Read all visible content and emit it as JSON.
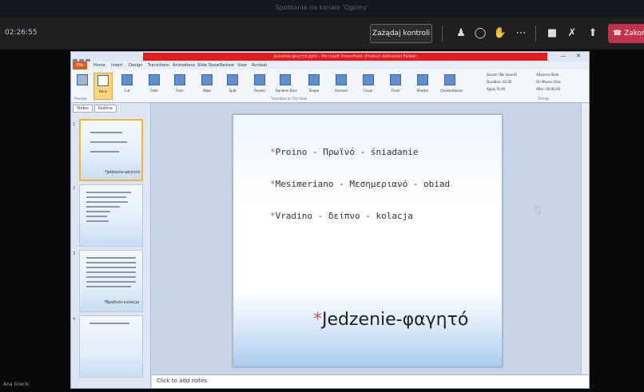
{
  "teams": {
    "window_title": "Spotkanie na kanale 'Ogólny'",
    "timer": "02:26:55",
    "request_control": "Zażądaj kontroli",
    "leave": "Zakończ",
    "participant": "Ana Grecki"
  },
  "powerpoint": {
    "title": "Jedzenie-φαγητό.pptx - Microsoft PowerPoint (Product Activation Failed)",
    "file_tab": "File",
    "tabs": [
      "Home",
      "Insert",
      "Design",
      "Transitions",
      "Animations",
      "Slide Show",
      "Review",
      "View",
      "Acrobat"
    ],
    "transitions": [
      "None",
      "Cut",
      "Fade",
      "Push",
      "Wipe",
      "Split",
      "Reveal",
      "Random Bars",
      "Shape",
      "Uncover",
      "Cover",
      "Flash",
      "Shutter",
      "Checkerboard"
    ],
    "groups": {
      "preview": "Preview",
      "transitions": "Transition to This Slide",
      "timing": "Timing"
    },
    "timing": {
      "sound": "Sound: [No Sound]",
      "duration": "Duration: 02,00",
      "apply": "Apply To All",
      "advance": "Advance Slide",
      "on_click": "On Mouse Click",
      "after": "After: 00:00,00"
    },
    "panel_tabs": [
      "Slides",
      "Outline"
    ],
    "thumbnails": [
      {
        "num": "1",
        "caption": "*Jedzenie-φαγητό"
      },
      {
        "num": "2",
        "caption": ""
      },
      {
        "num": "3",
        "caption": "*Βραδινό-κολαcja"
      },
      {
        "num": "4",
        "caption": ""
      }
    ],
    "slide": {
      "bullets": [
        "Proino      - Πρωϊνό - śniadanie",
        "Mesimeriano - Μεσημεριανό - obiad",
        "Vradino - δείπνο - kolacja"
      ],
      "title": "Jedzenie-φαγητό"
    },
    "notes_placeholder": "Click to add notes"
  },
  "colors": {
    "accent_red": "#e21d1d",
    "leave_red": "#c4314b",
    "selection": "#f2b632"
  }
}
